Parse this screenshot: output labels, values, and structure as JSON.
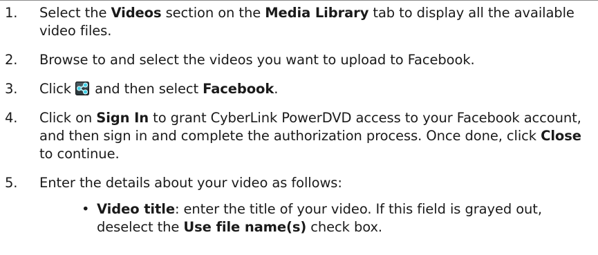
{
  "steps": [
    {
      "number": "1.",
      "parts": [
        {
          "t": "Select the "
        },
        {
          "t": "Videos",
          "bold": true
        },
        {
          "t": " section on the "
        },
        {
          "t": "Media Library",
          "bold": true
        },
        {
          "t": " tab to display all the available video files."
        }
      ]
    },
    {
      "number": "2.",
      "parts": [
        {
          "t": "Browse to and select the videos you want to upload to Facebook."
        }
      ]
    },
    {
      "number": "3.",
      "parts": [
        {
          "t": "Click "
        },
        {
          "icon": "share-icon"
        },
        {
          "t": " and then select "
        },
        {
          "t": "Facebook",
          "bold": true
        },
        {
          "t": "."
        }
      ]
    },
    {
      "number": "4.",
      "parts": [
        {
          "t": "Click on "
        },
        {
          "t": "Sign In",
          "bold": true
        },
        {
          "t": " to grant CyberLink PowerDVD access to your Facebook account, and then sign in and complete the authorization process. Once done, click "
        },
        {
          "t": "Close",
          "bold": true
        },
        {
          "t": " to continue."
        }
      ]
    },
    {
      "number": "5.",
      "parts": [
        {
          "t": "Enter the details about your video as follows:"
        }
      ],
      "subitems": [
        {
          "bullet": "•",
          "parts": [
            {
              "t": "Video title",
              "bold": true
            },
            {
              "t": ": enter the title of your video. If this field is grayed out, deselect the "
            },
            {
              "t": "Use file name(s)",
              "bold": true
            },
            {
              "t": " check box."
            }
          ]
        }
      ]
    }
  ]
}
